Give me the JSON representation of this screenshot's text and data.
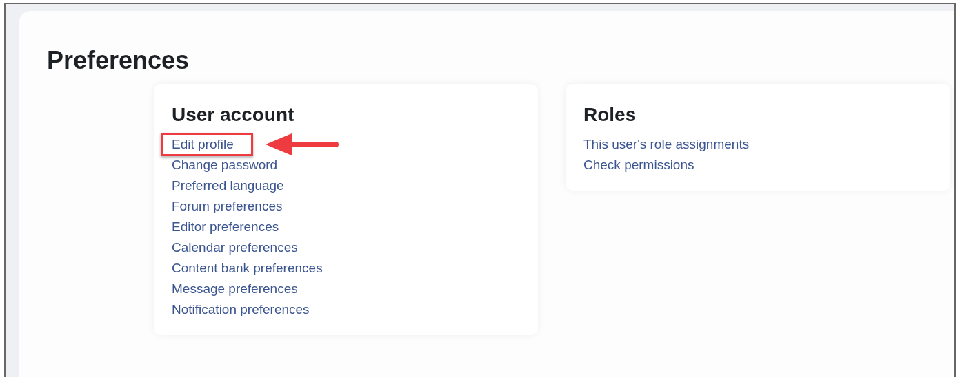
{
  "page": {
    "title": "Preferences"
  },
  "cards": [
    {
      "title": "User account",
      "links": [
        {
          "label": "Edit profile",
          "highlighted": true
        },
        {
          "label": "Change password",
          "highlighted": false
        },
        {
          "label": "Preferred language",
          "highlighted": false
        },
        {
          "label": "Forum preferences",
          "highlighted": false
        },
        {
          "label": "Editor preferences",
          "highlighted": false
        },
        {
          "label": "Calendar preferences",
          "highlighted": false
        },
        {
          "label": "Content bank preferences",
          "highlighted": false
        },
        {
          "label": "Message preferences",
          "highlighted": false
        },
        {
          "label": "Notification preferences",
          "highlighted": false
        }
      ]
    },
    {
      "title": "Roles",
      "links": [
        {
          "label": "This user's role assignments",
          "highlighted": false
        },
        {
          "label": "Check permissions",
          "highlighted": false
        }
      ]
    }
  ]
}
